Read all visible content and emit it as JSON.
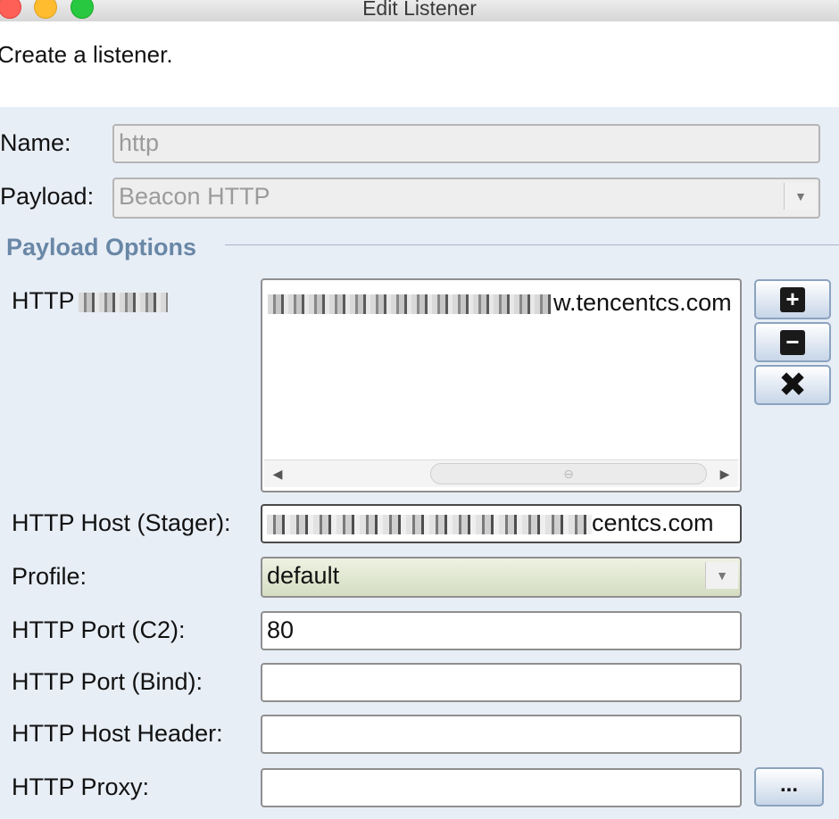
{
  "window": {
    "title": "Edit Listener"
  },
  "description": "Create a listener.",
  "form": {
    "name_label": "Name:",
    "name_value": "http",
    "payload_label": "Payload:",
    "payload_value": "Beacon HTTP",
    "section_title": "Payload Options",
    "hosts_label": "HTTP",
    "hosts_value_visible": "w.tencentcs.com",
    "stager_label": "HTTP Host (Stager):",
    "stager_value_visible": "centcs.com",
    "profile_label": "Profile:",
    "profile_value": "default",
    "port_c2_label": "HTTP Port (C2):",
    "port_c2_value": "80",
    "port_bind_label": "HTTP Port (Bind):",
    "port_bind_value": "",
    "host_header_label": "HTTP Host Header:",
    "host_header_value": "",
    "proxy_label": "HTTP Proxy:",
    "proxy_value": "",
    "proxy_button_label": "..."
  },
  "buttons": {
    "add": "+",
    "remove": "−",
    "clear": "✖"
  },
  "icons": [
    "plus-icon",
    "minus-icon",
    "close-icon",
    "chevron-down-icon",
    "arrow-left-icon",
    "arrow-right-icon"
  ],
  "colors": {
    "section_title": "#6987a6",
    "profile_bg": "#d9e1c8",
    "background": "#e8eef6"
  }
}
